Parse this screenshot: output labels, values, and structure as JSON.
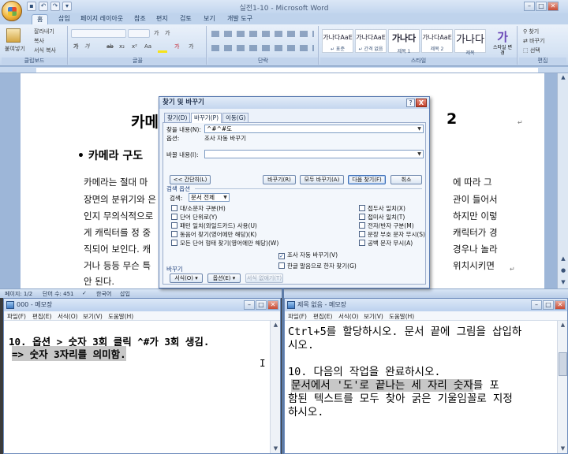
{
  "word": {
    "title": "실전1-10 - Microsoft Word",
    "qat_icons": [
      "save-icon",
      "undo-icon",
      "redo-icon",
      "dropdown-icon"
    ],
    "tabs": [
      "홈",
      "삽입",
      "페이지 레이아웃",
      "참조",
      "편지",
      "검토",
      "보기",
      "개발 도구"
    ],
    "active_tab": "홈",
    "ribbon": {
      "clipboard": {
        "paste": "붙여넣기",
        "cut": "잘라내기",
        "copy": "복사",
        "format_painter": "서식 복사",
        "label": "클립보드"
      },
      "font": {
        "label": "글꼴",
        "font_buttons": [
          "가",
          "가",
          "가",
          "가",
          "ab",
          "x₂",
          "x²",
          "Aa",
          "가",
          "가"
        ]
      },
      "paragraph": {
        "label": "단락"
      },
      "styles": {
        "label": "스타일",
        "items": [
          {
            "sample": "가나다AaE",
            "name": "↵ 표준"
          },
          {
            "sample": "가나다AaE",
            "name": "↵ 간격 없음"
          },
          {
            "sample": "가나다",
            "name": "제목 1"
          },
          {
            "sample": "가나다AaE",
            "name": "제목 2"
          },
          {
            "sample": "가나다",
            "name": "제목"
          }
        ],
        "change_styles": "스타일 변경"
      },
      "editing": {
        "label": "편집",
        "find": "찾기",
        "replace": "바꾸기",
        "select": "선택"
      }
    },
    "doc": {
      "heading": "카메",
      "heading_tail": "2",
      "subheading": "카메라 구도",
      "lines": [
        {
          "left": "카메라는 절대 마",
          "right": "에 따라 그"
        },
        {
          "left": "장면의 분위기와 은",
          "right": "관이 들어서"
        },
        {
          "left": "인지 무의식적으로",
          "right": "하지만 이렇"
        },
        {
          "left": "게 캐릭터를 정 중",
          "right": "캐릭터가 경"
        },
        {
          "left": "직되어 보인다. 캐",
          "right": "경우나 놀라"
        },
        {
          "left": "거나 등등 무슨 특",
          "right": "위치시키면"
        },
        {
          "left": "안 된다.",
          "right": ""
        }
      ]
    },
    "status": {
      "page": "페이지: 1/2",
      "words": "단어 수: 451",
      "lang": "한국어",
      "mode": "삽입"
    }
  },
  "dialog": {
    "title": "찾기 및 바꾸기",
    "help": "?",
    "close": "X",
    "tabs": [
      "찾기(D)",
      "바꾸기(P)",
      "이동(G)"
    ],
    "active_tab": "바꾸기(P)",
    "find_label": "찾을 내용(N):",
    "find_value": "^#^#도",
    "options_label": "옵션:",
    "options_value": "조사 자동 바꾸기",
    "replace_label": "바꿀 내용(I):",
    "replace_value": "",
    "less_button": "<< 간단히(L)",
    "replace_button": "바꾸기(R)",
    "replace_all_button": "모두 바꾸기(A)",
    "find_next_button": "다음 찾기(F)",
    "cancel_button": "취소",
    "search_options_title": "검색 옵션",
    "search_label": "검색:",
    "search_value": "문서 전체",
    "checks_left": [
      "대/소문자 구분(H)",
      "단어 단위로(Y)",
      "패턴 일치(와일드카드) 사용(U)",
      "동음어 찾기(영어에만 해당)(K)",
      "모든 단어 형태 찾기(영어에만 해당)(W)"
    ],
    "checks_right": [
      "접두사 일치(X)",
      "접미사 일치(T)",
      "전자/반자 구분(M)",
      "문장 부호 문자 무시(S)",
      "공백 문자 무시(A)"
    ],
    "check_josa": "조사 자동 바꾸기(V)",
    "check_josa_checked": true,
    "check_hangul": "한글 말음으로 한자 찾기(G)",
    "replace_section": "바꾸기",
    "format_button": "서식(O)",
    "special_button": "옵션(E)",
    "no_format_button": "서식 없애기(T)"
  },
  "notepad_left": {
    "title": "000 - 메모장",
    "menu": [
      "파일(F)",
      "편집(E)",
      "서식(O)",
      "보기(V)",
      "도움말(H)"
    ],
    "line1": "10. 옵션 > 숫자 3회 클릭 ^#가 3회 생김.",
    "line2": "=> 숫자 3자리를 의미함."
  },
  "notepad_right": {
    "title": "제목 없음 - 메모장",
    "menu": [
      "파일(F)",
      "편집(E)",
      "서식(O)",
      "보기(V)",
      "도움말(H)"
    ],
    "line1": "Ctrl+5를 할당하시오. 문서 끝에 그림을 삽입하",
    "line2": "시오.",
    "line3": "10. 다음의 작업을 완료하시오.",
    "line4_hl": "문서에서 '도'로 끝나는 세 자리 숫자",
    "line4_rest": "를 포",
    "line5": "함된 텍스트를 모두 찾아 굵은 기울임꼴로 지정",
    "line6": "하시오."
  }
}
